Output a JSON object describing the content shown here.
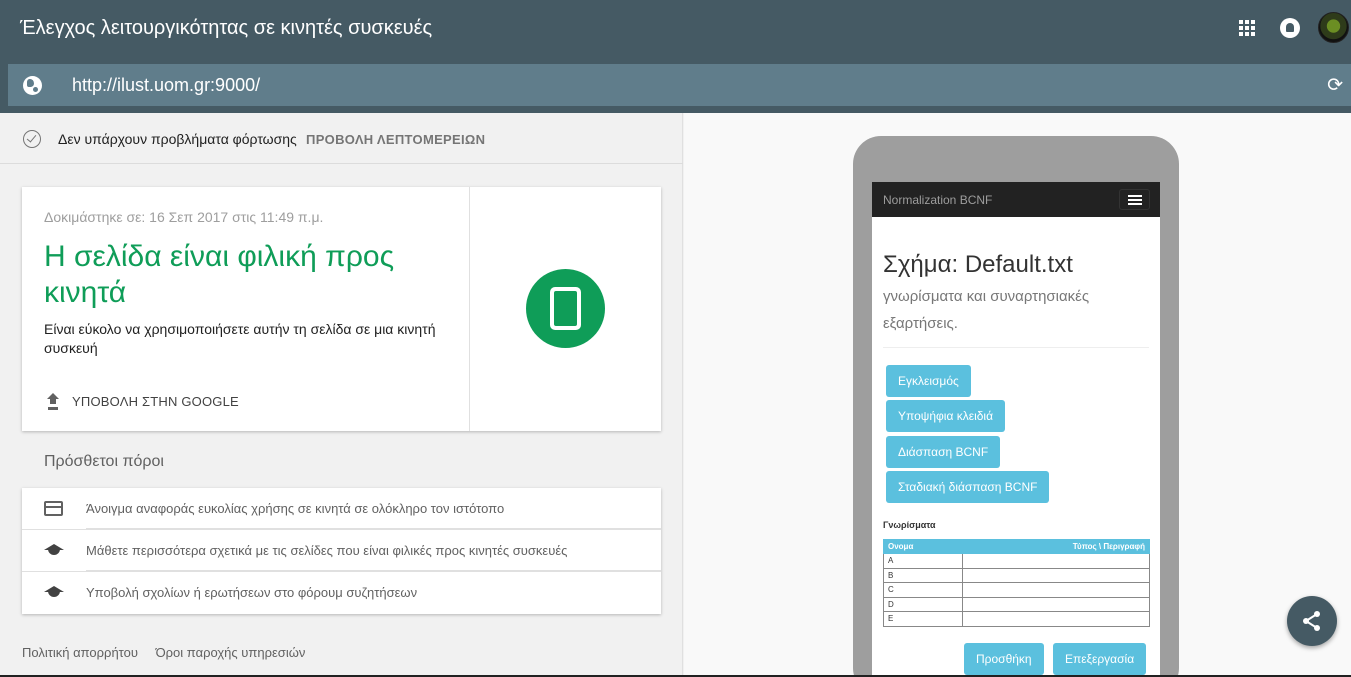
{
  "header": {
    "title": "Έλεγχος λειτουργικότητας σε κινητές συσκευές",
    "url": "http://ilust.uom.gr:9000/"
  },
  "status": {
    "text": "Δεν υπάρχουν προβλήματα φόρτωσης",
    "details_link": "ΠΡΟΒΟΛΗ ΛΕΠΤΟΜΕΡΕΙΩΝ"
  },
  "result": {
    "tested": "Δοκιμάστηκε σε: 16 Σεπ 2017 στις 11:49 π.μ.",
    "headline": "Η σελίδα είναι φιλική προς κινητά",
    "description": "Είναι εύκολο να χρησιμοποιήσετε αυτήν τη σελίδα σε μια κινητή συσκευή",
    "submit_label": "ΥΠΟΒΟΛΗ ΣΤΗΝ GOOGLE",
    "accent": "#0f9d58"
  },
  "resources": {
    "title": "Πρόσθετοι πόροι",
    "items": [
      {
        "icon": "web-icon",
        "label": "Άνοιγμα αναφοράς ευκολίας χρήσης σε κινητά σε ολόκληρο τον ιστότοπο"
      },
      {
        "icon": "school-icon",
        "label": "Μάθετε περισσότερα σχετικά με τις σελίδες που είναι φιλικές προς κινητές συσκευές"
      },
      {
        "icon": "school-icon",
        "label": "Υποβολή σχολίων ή ερωτήσεων στο φόρουμ συζητήσεων"
      }
    ]
  },
  "footer": {
    "privacy": "Πολιτική απορρήτου",
    "terms": "Όροι παροχής υπηρεσιών"
  },
  "preview": {
    "brand": "Normalization BCNF",
    "heading": "Σχήμα: Default.txt",
    "subheading": "γνωρίσματα και συναρτησιακές εξαρτήσεις.",
    "buttons": [
      "Εγκλεισμός",
      "Υποψήφια κλειδιά",
      "Διάσπαση BCNF",
      "Σταδιακή διάσπαση BCNF"
    ],
    "table_label": "Γνωρίσματα",
    "table_headers": [
      "Ονομα",
      "Τύπος \\ Περιγραφή"
    ],
    "table_rows": [
      "A",
      "B",
      "C",
      "D",
      "E"
    ],
    "add_button": "Προσθήκη",
    "edit_button": "Επεξεργασία",
    "button_color": "#5bc0de"
  }
}
